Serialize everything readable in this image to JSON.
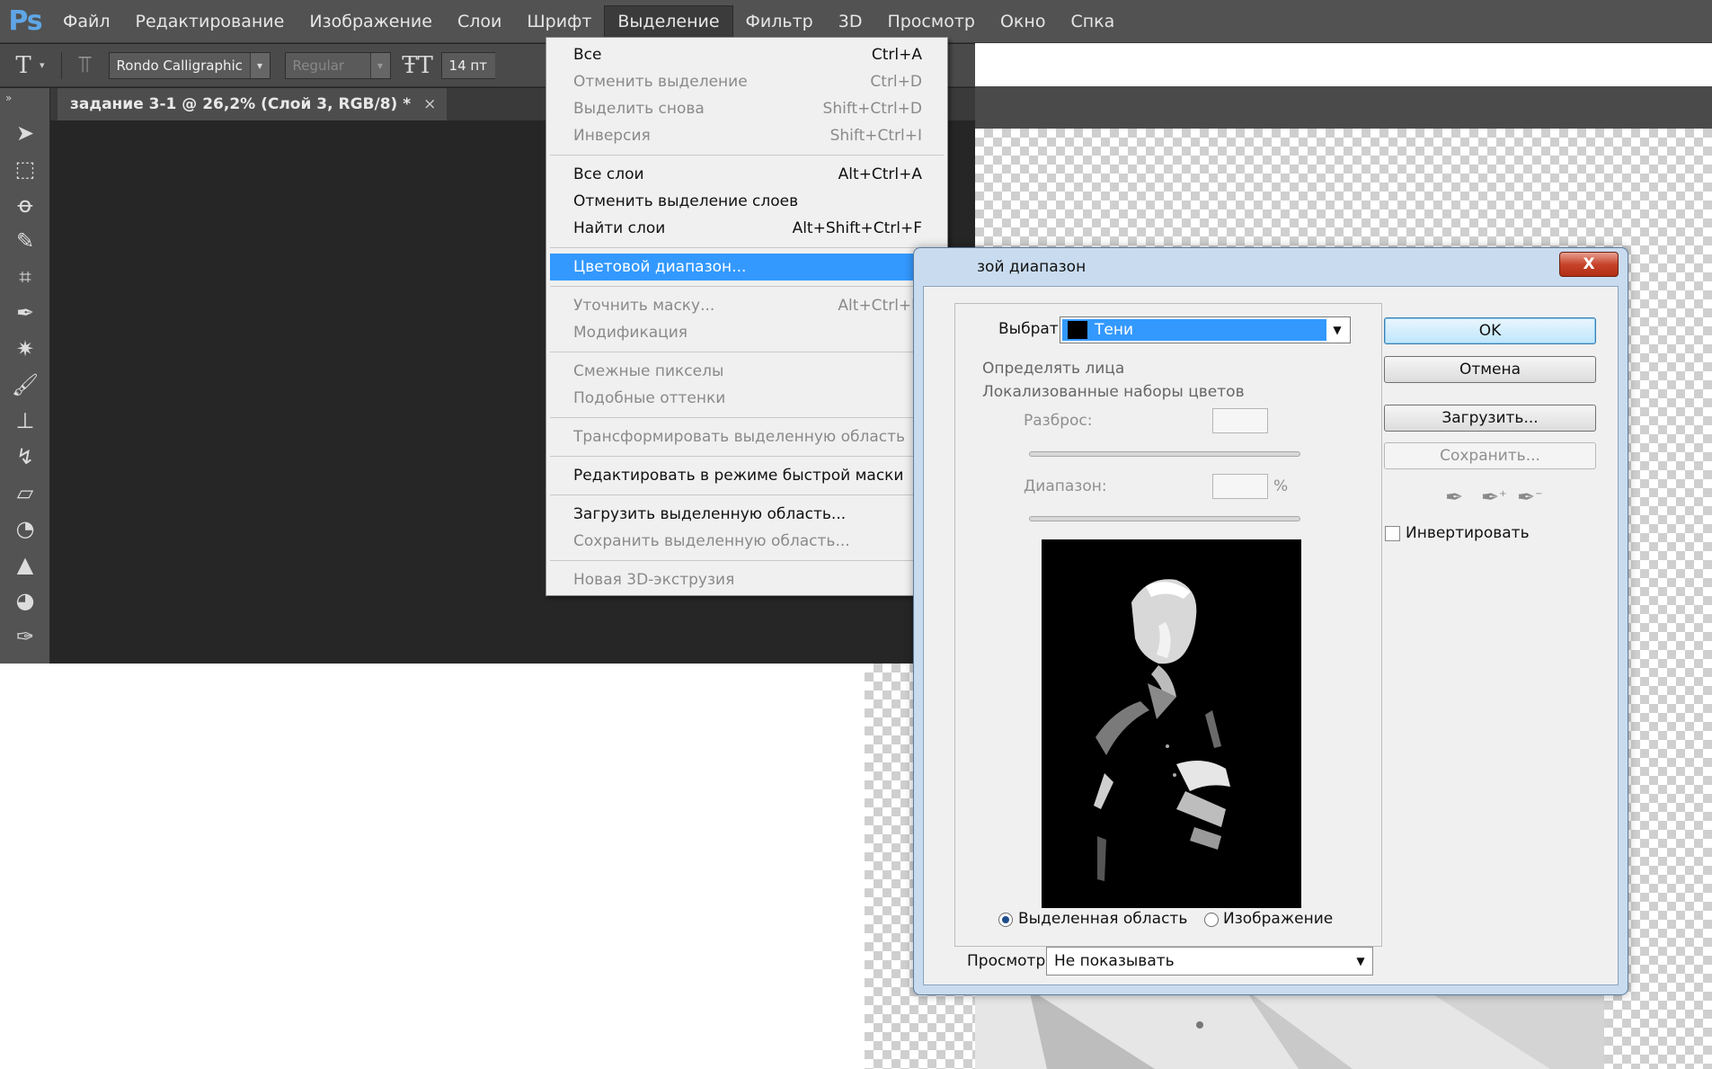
{
  "app": {
    "logo": "Ps",
    "menu": [
      "Файл",
      "Редактирование",
      "Изображение",
      "Слои",
      "Шрифт",
      "Выделение",
      "Фильтр",
      "3D",
      "Просмотр",
      "Окно",
      "Спка"
    ],
    "active_menu_index": 5
  },
  "options": {
    "type_tool_icon": "T",
    "font_family": "Rondo Calligraphic",
    "font_style": "Regular",
    "font_size": "14 пт"
  },
  "document": {
    "tab_title": "задание 3-1 @ 26,2% (Слой 3, RGB/8) *",
    "tab_close": "×"
  },
  "select_menu": {
    "groups": [
      [
        {
          "label": "Все",
          "shortcut": "Ctrl+A",
          "enabled": true
        },
        {
          "label": "Отменить выделение",
          "shortcut": "Ctrl+D",
          "enabled": false
        },
        {
          "label": "Выделить снова",
          "shortcut": "Shift+Ctrl+D",
          "enabled": false
        },
        {
          "label": "Инверсия",
          "shortcut": "Shift+Ctrl+I",
          "enabled": false
        }
      ],
      [
        {
          "label": "Все слои",
          "shortcut": "Alt+Ctrl+A",
          "enabled": true
        },
        {
          "label": "Отменить выделение слоев",
          "shortcut": "",
          "enabled": true
        },
        {
          "label": "Найти слои",
          "shortcut": "Alt+Shift+Ctrl+F",
          "enabled": true
        }
      ],
      [
        {
          "label": "Цветовой диапазон...",
          "shortcut": "",
          "enabled": true,
          "highlighted": true
        }
      ],
      [
        {
          "label": "Уточнить маску...",
          "shortcut": "Alt+Ctrl+R",
          "enabled": false
        },
        {
          "label": "Модификация",
          "shortcut": "",
          "enabled": false,
          "submenu": true
        }
      ],
      [
        {
          "label": "Смежные пикселы",
          "shortcut": "",
          "enabled": false
        },
        {
          "label": "Подобные оттенки",
          "shortcut": "",
          "enabled": false
        }
      ],
      [
        {
          "label": "Трансформировать выделенную область",
          "shortcut": "",
          "enabled": false
        }
      ],
      [
        {
          "label": "Редактировать в режиме быстрой маски",
          "shortcut": "",
          "enabled": true
        }
      ],
      [
        {
          "label": "Загрузить выделенную область...",
          "shortcut": "",
          "enabled": true
        },
        {
          "label": "Сохранить выделенную область...",
          "shortcut": "",
          "enabled": false
        }
      ],
      [
        {
          "label": "Новая 3D-экструзия",
          "shortcut": "",
          "enabled": false
        }
      ]
    ]
  },
  "dialog": {
    "title": "зой диапазон",
    "close_label": "X",
    "select_label": "Выбрать:",
    "select_value": "Тени",
    "detect_faces": "Определять лица",
    "localized": "Локализованные наборы цветов",
    "fuzziness_label": "Разброс:",
    "range_label": "Диапазон:",
    "range_unit": "%",
    "radio_selection": "Выделенная область",
    "radio_image": "Изображение",
    "preview_label": "Просмотр:",
    "preview_value": "Не показывать",
    "ok": "OK",
    "cancel": "Отмена",
    "load": "Загрузить...",
    "save": "Сохранить...",
    "invert": "Инвертировать"
  }
}
